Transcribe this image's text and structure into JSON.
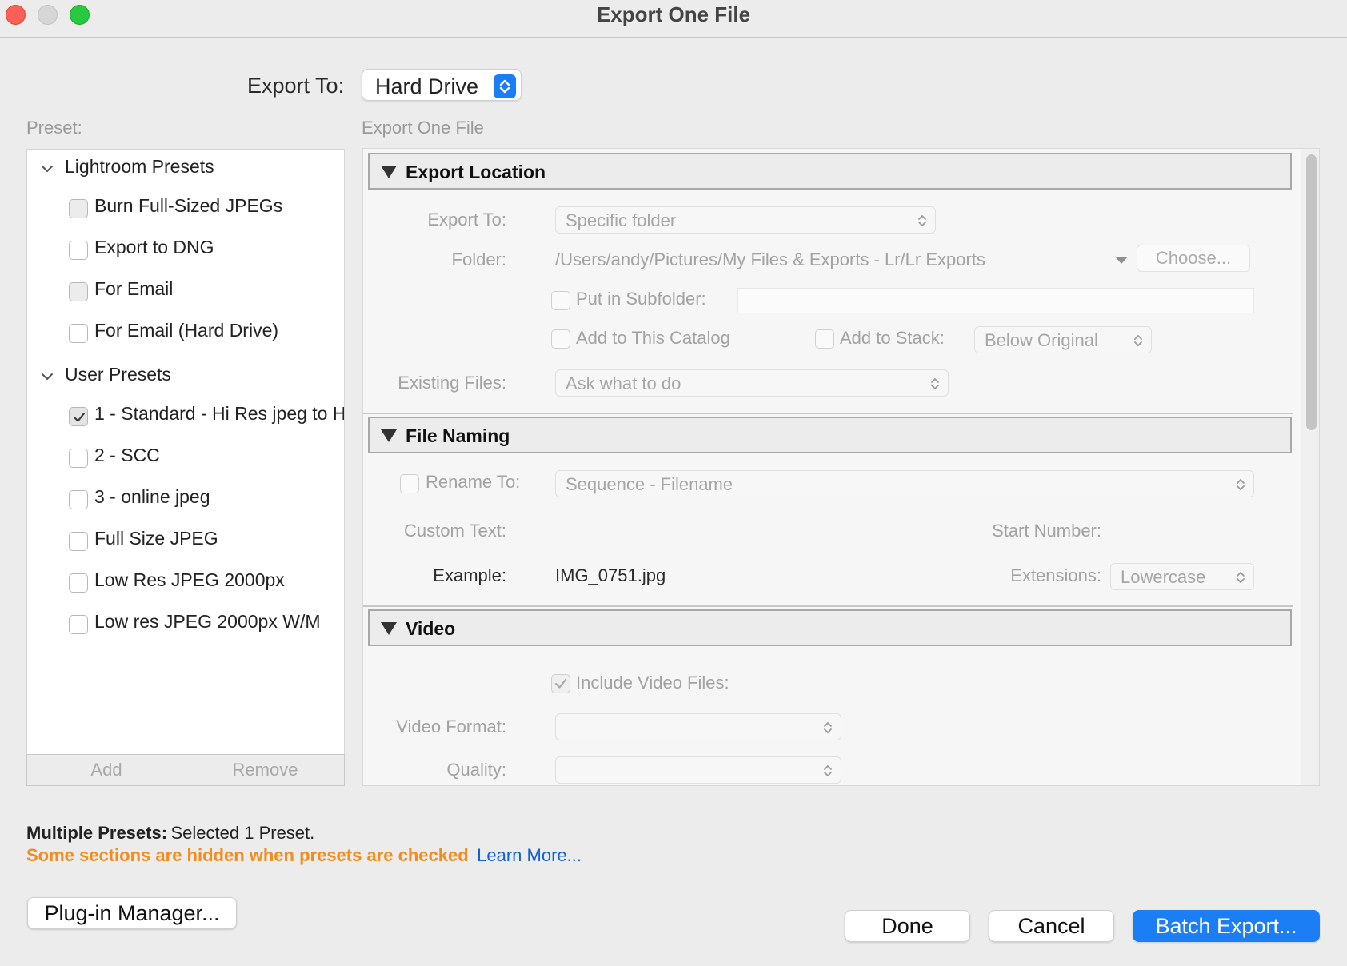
{
  "window": {
    "title": "Export One File",
    "buttons": {
      "close_color": "#fe5f57",
      "minimize_color": "#d6d6d6",
      "zoom_color": "#28c840"
    }
  },
  "export_to": {
    "label": "Export To:",
    "value": "Hard Drive"
  },
  "preset_panel": {
    "label": "Preset:",
    "groups": [
      {
        "name": "Lightroom Presets",
        "items": [
          {
            "label": "Burn Full-Sized JPEGs",
            "checked": false,
            "enabled": false
          },
          {
            "label": "Export to DNG",
            "checked": false,
            "enabled": true
          },
          {
            "label": "For Email",
            "checked": false,
            "enabled": false
          },
          {
            "label": "For Email (Hard Drive)",
            "checked": false,
            "enabled": true
          }
        ]
      },
      {
        "name": "User Presets",
        "items": [
          {
            "label": "1 - Standard - Hi Res jpeg to H",
            "checked": true,
            "enabled": true
          },
          {
            "label": "2 - SCC",
            "checked": false,
            "enabled": true
          },
          {
            "label": "3 - online jpeg",
            "checked": false,
            "enabled": true
          },
          {
            "label": "Full Size JPEG",
            "checked": false,
            "enabled": true
          },
          {
            "label": "Low Res JPEG 2000px",
            "checked": false,
            "enabled": true
          },
          {
            "label": "Low res JPEG 2000px W/M",
            "checked": false,
            "enabled": true
          }
        ]
      }
    ],
    "add_label": "Add",
    "remove_label": "Remove"
  },
  "settings_panel": {
    "label": "Export One File",
    "sections": {
      "export_location": {
        "title": "Export Location",
        "export_to_label": "Export To:",
        "export_to_value": "Specific folder",
        "folder_label": "Folder:",
        "folder_path": "/Users/andy/Pictures/My Files & Exports - Lr/Lr Exports",
        "choose_label": "Choose...",
        "subfolder_label": "Put in Subfolder:",
        "add_catalog_label": "Add to This Catalog",
        "add_stack_label": "Add to Stack:",
        "stack_value": "Below Original",
        "existing_files_label": "Existing Files:",
        "existing_files_value": "Ask what to do"
      },
      "file_naming": {
        "title": "File Naming",
        "rename_label": "Rename To:",
        "rename_value": "Sequence - Filename",
        "custom_text_label": "Custom Text:",
        "start_number_label": "Start Number:",
        "example_label": "Example:",
        "example_value": "IMG_0751.jpg",
        "extensions_label": "Extensions:",
        "extensions_value": "Lowercase"
      },
      "video": {
        "title": "Video",
        "include_label": "Include Video Files:",
        "include_checked": true,
        "format_label": "Video Format:",
        "quality_label": "Quality:"
      }
    }
  },
  "footer": {
    "multiple_label": "Multiple Presets:",
    "multiple_value": "Selected 1 Preset.",
    "warning": "Some sections are hidden when presets are checked",
    "learn_more": "Learn More...",
    "plugin_manager": "Plug-in Manager...",
    "done": "Done",
    "cancel": "Cancel",
    "batch_export": "Batch Export..."
  },
  "colors": {
    "accent": "#1c7ef5",
    "warning": "#f18c1e",
    "link": "#1160d9"
  }
}
